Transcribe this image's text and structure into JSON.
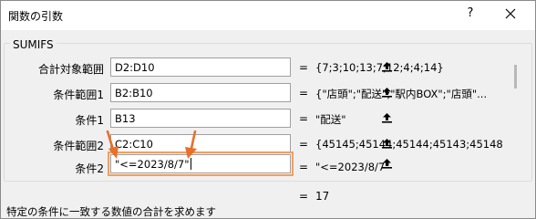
{
  "window": {
    "title": "関数の引数",
    "help": "?"
  },
  "function_name": "SUMIFS",
  "arguments": [
    {
      "label": "合計対象範囲",
      "value": "D2:D10",
      "result": "{7;3;10;13;7;12;4;4;14}"
    },
    {
      "label": "条件範囲1",
      "value": "B2:B10",
      "result": "{\"店頭\";\"配送\";\"駅内BOX\";\"店頭\"..."
    },
    {
      "label": "条件1",
      "value": "B13",
      "result": "\"配送\""
    },
    {
      "label": "条件範囲2",
      "value": "C2:C10",
      "result": "{45145;45144;45144;45143;45148"
    },
    {
      "label": "条件2",
      "value": "\"<=2023/8/7\"",
      "result": "\"<=2023/8/7\""
    }
  ],
  "equals_sign": "=",
  "formula_result": "17",
  "description": "特定の条件に一致する数値の合計を求めます",
  "colors": {
    "highlight": "#f0a060",
    "arrow": "#e8702a"
  },
  "icons": [
    "help-icon",
    "close-icon",
    "collapse-ref-icon",
    "pointer-arrow-icon"
  ]
}
